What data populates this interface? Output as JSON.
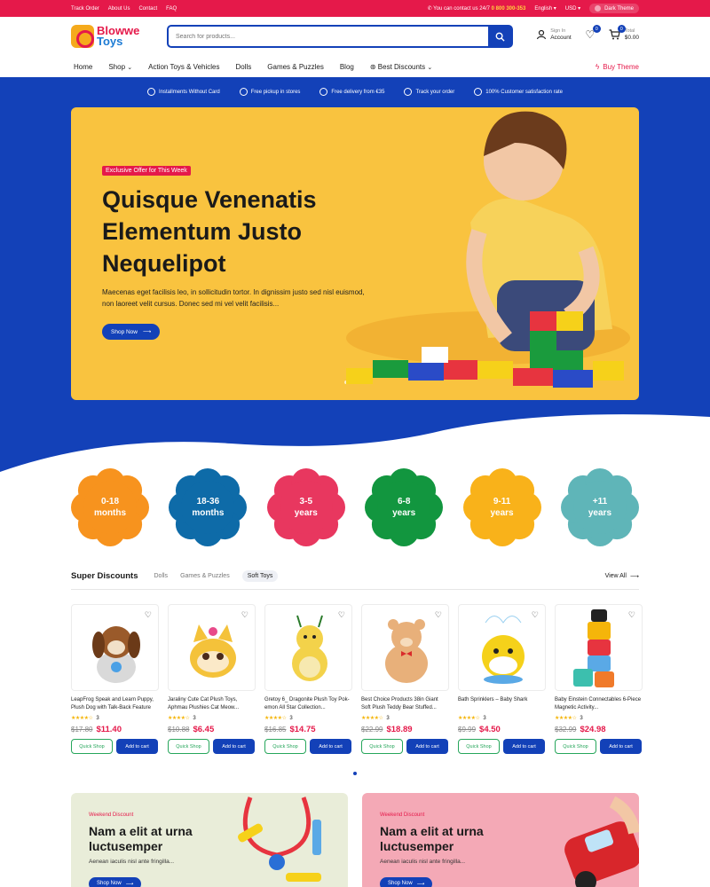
{
  "topbar": {
    "links": [
      "Track Order",
      "About Us",
      "Contact",
      "FAQ"
    ],
    "contact_text": "You can contact us 24/7",
    "phone": "0 800 300-353",
    "language": "English",
    "currency": "USD",
    "dark_theme": "Dark Theme"
  },
  "header": {
    "logo_line1": "Blowwe",
    "logo_line2": "Toys",
    "search_placeholder": "Search for products...",
    "sign_in": "Sign In",
    "account": "Account",
    "wishlist_count": "0",
    "cart_count": "0",
    "cart_total_label": "Total",
    "cart_total": "$0.00"
  },
  "nav": {
    "items": [
      "Home",
      "Shop",
      "Action Toys & Vehicles",
      "Dolls",
      "Games & Puzzles",
      "Blog",
      "Best Discounts"
    ],
    "buy_theme": "Buy Theme"
  },
  "features": [
    "Installments Without Card",
    "Free pickup in stores",
    "Free delivery from €35",
    "Track your order",
    "100% Customer satisfaction rate"
  ],
  "hero": {
    "tag": "Exclusive Offer for This Week",
    "title": "Quisque Venenatis Elementum Justo Nequelipot",
    "text": "Maecenas eget facilisis leo, in sollicitudin tortor. In dignissim justo sed nisl euismod, non laoreet velit cursus. Donec sed mi vel velit facilisis...",
    "cta": "Shop Now"
  },
  "ages": [
    {
      "line1": "0-18",
      "line2": "months",
      "color": "#f7931e"
    },
    {
      "line1": "18-36",
      "line2": "months",
      "color": "#0e6ba8"
    },
    {
      "line1": "3-5",
      "line2": "years",
      "color": "#e8375f"
    },
    {
      "line1": "6-8",
      "line2": "years",
      "color": "#12963f"
    },
    {
      "line1": "9-11",
      "line2": "years",
      "color": "#f9b21a"
    },
    {
      "line1": "+11",
      "line2": "years",
      "color": "#5fb5b8"
    }
  ],
  "super_discounts": {
    "title": "Super Discounts",
    "tabs": [
      "Dolls",
      "Games & Puzzles",
      "Soft Toys"
    ],
    "active_tab": "Soft Toys",
    "view_all": "View All",
    "quick_shop": "Quick Shop",
    "add_to_cart": "Add to cart",
    "products": [
      {
        "name": "LeapFrog Speak and Learn Puppy, Plush Dog with Talk-Back Feature",
        "rating": "3",
        "old": "$17.80",
        "new": "$11.40"
      },
      {
        "name": "Jaraliny Cute Cat Plush Toys, Aphmau Plushies Cat Meow...",
        "rating": "3",
        "old": "$10.88",
        "new": "$6.45"
      },
      {
        "name": "Gretoy 6_ Dragonite Plush Toy Pok-emon All Star Collection...",
        "rating": "3",
        "old": "$16.85",
        "new": "$14.75"
      },
      {
        "name": "Best Choice Products 38in Giant Soft Plush Teddy Bear Stuffed...",
        "rating": "3",
        "old": "$22.99",
        "new": "$18.89"
      },
      {
        "name": "Bath Sprinklers – Baby Shark",
        "rating": "3",
        "old": "$9.99",
        "new": "$4.50"
      },
      {
        "name": "Baby Einstein Connectables 6-Piece Magnetic Activity...",
        "rating": "3",
        "old": "$32.99",
        "new": "$24.98"
      }
    ]
  },
  "banners": [
    {
      "tag": "Weekend Discount",
      "title": "Nam a elit at urna luctusemper",
      "text": "Aenean iaculis nisl ante fringilla...",
      "cta": "Shop Now"
    },
    {
      "tag": "Weekend Discount",
      "title": "Nam a elit at urna luctusemper",
      "text": "Aenean iaculis nisl ante fringilla...",
      "cta": "Shop Now"
    }
  ],
  "colors": {
    "accent": "#e5194a",
    "primary": "#1341b8",
    "hero_bg": "#f9c33f"
  }
}
